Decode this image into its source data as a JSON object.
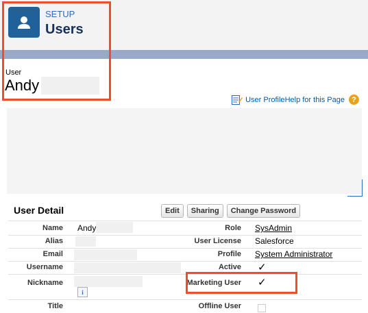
{
  "header": {
    "setup_label": "SETUP",
    "title": "Users"
  },
  "user": {
    "caption": "User",
    "name": "Andy"
  },
  "help": {
    "profile_link": "User Profile",
    "help_link": "Help for this Page"
  },
  "detail": {
    "section_title": "User Detail",
    "buttons": {
      "edit": "Edit",
      "sharing": "Sharing",
      "change_password": "Change Password"
    },
    "left": [
      {
        "label": "Name",
        "value": "Andy"
      },
      {
        "label": "Alias",
        "value": ""
      },
      {
        "label": "Email",
        "value": ""
      },
      {
        "label": "Username",
        "value": ""
      },
      {
        "label": "Nickname",
        "value": ""
      },
      {
        "label": "Title",
        "value": ""
      }
    ],
    "right": [
      {
        "label": "Role",
        "value": "SysAdmin"
      },
      {
        "label": "User License",
        "value": "Salesforce"
      },
      {
        "label": "Profile",
        "value": "System Administrator"
      },
      {
        "label": "Active",
        "value": "✓"
      },
      {
        "label": "Marketing User",
        "value": "✓"
      },
      {
        "label": "Offline User",
        "value": ""
      }
    ],
    "info_icon": "i"
  },
  "colors": {
    "accent": "#20619a",
    "highlight": "#f04d2d",
    "band": "#9aa9c7"
  },
  "icons": [
    "user-icon",
    "user-profile-icon",
    "help-icon",
    "info-icon",
    "checkmark-icon"
  ]
}
